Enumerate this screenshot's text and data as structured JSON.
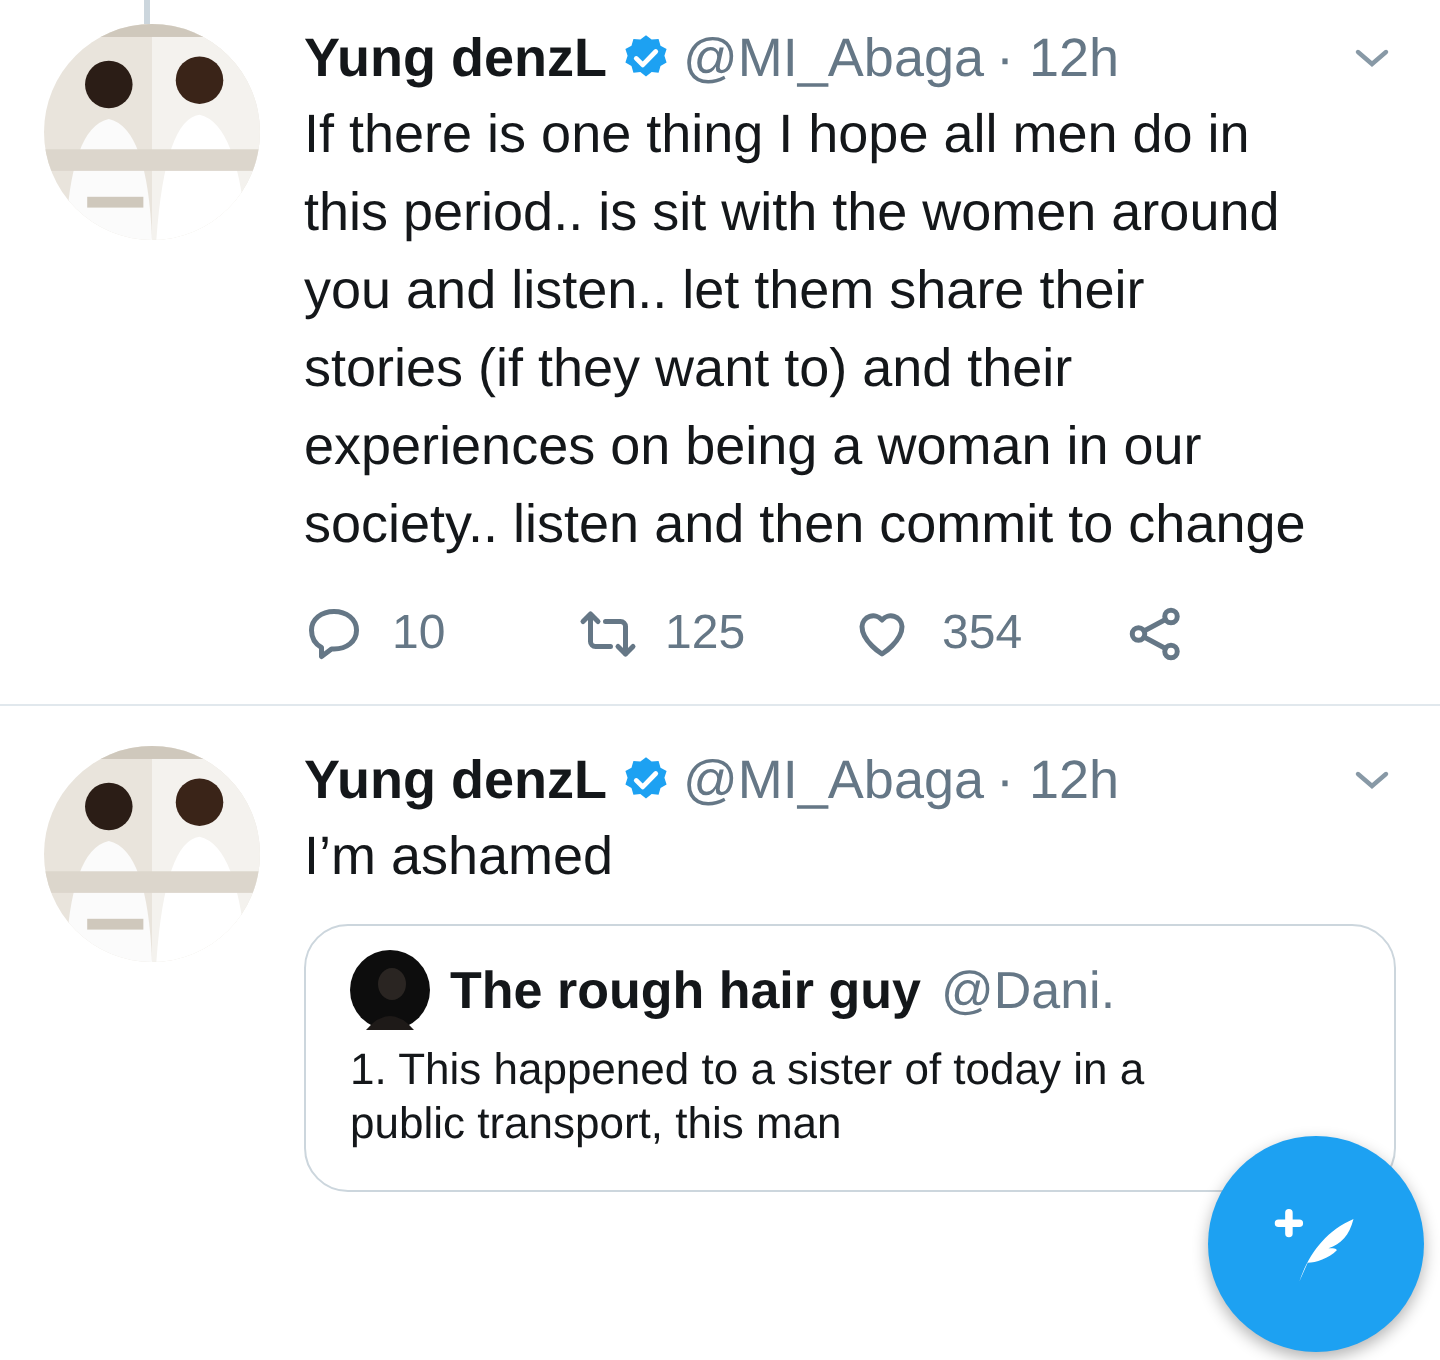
{
  "tweets": [
    {
      "author": {
        "name": "Yung denzL",
        "verified": true,
        "handle": "@MI_Abaga",
        "time": "· 12h"
      },
      "thread": true,
      "text": "If there is one thing I hope all men do in this period.. is sit with the women around you and listen.. let them share their stories (if they want to) and their experiences on being a woman in our society.. listen and then commit to change",
      "actions": [
        {
          "kind": "reply",
          "count": "10"
        },
        {
          "kind": "retweet",
          "count": "125"
        },
        {
          "kind": "like",
          "count": "354"
        },
        {
          "kind": "share"
        }
      ]
    },
    {
      "author": {
        "name": "Yung denzL",
        "verified": true,
        "handle": "@MI_Abaga",
        "time": "· 12h"
      },
      "thread": false,
      "text": "I’m ashamed",
      "quote": {
        "name": "The rough hair guy",
        "handle": "@Dani.",
        "text": "1. This happened to a sister of today in a public transport, this man"
      }
    }
  ]
}
